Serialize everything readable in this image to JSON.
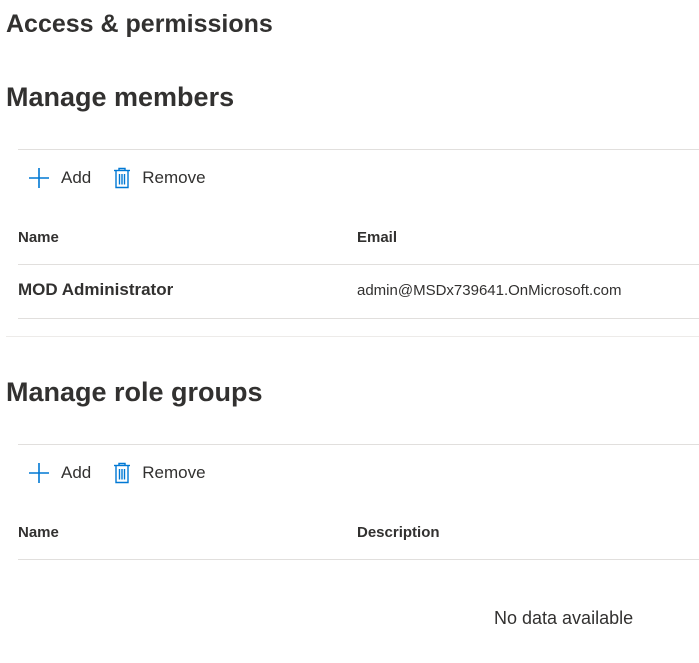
{
  "page": {
    "title": "Access & permissions"
  },
  "members": {
    "title": "Manage members",
    "toolbar": {
      "add_label": "Add",
      "remove_label": "Remove"
    },
    "columns": [
      "Name",
      "Email"
    ],
    "rows": [
      {
        "name": "MOD Administrator",
        "email": "admin@MSDx739641.OnMicrosoft.com"
      }
    ]
  },
  "role_groups": {
    "title": "Manage role groups",
    "toolbar": {
      "add_label": "Add",
      "remove_label": "Remove"
    },
    "columns": [
      "Name",
      "Description"
    ],
    "empty_message": "No data available"
  },
  "icons": {
    "add": "plus-icon",
    "remove": "trash-icon"
  },
  "colors": {
    "accent": "#0078d4",
    "text": "#323130",
    "divider": "#e1dfdd"
  }
}
